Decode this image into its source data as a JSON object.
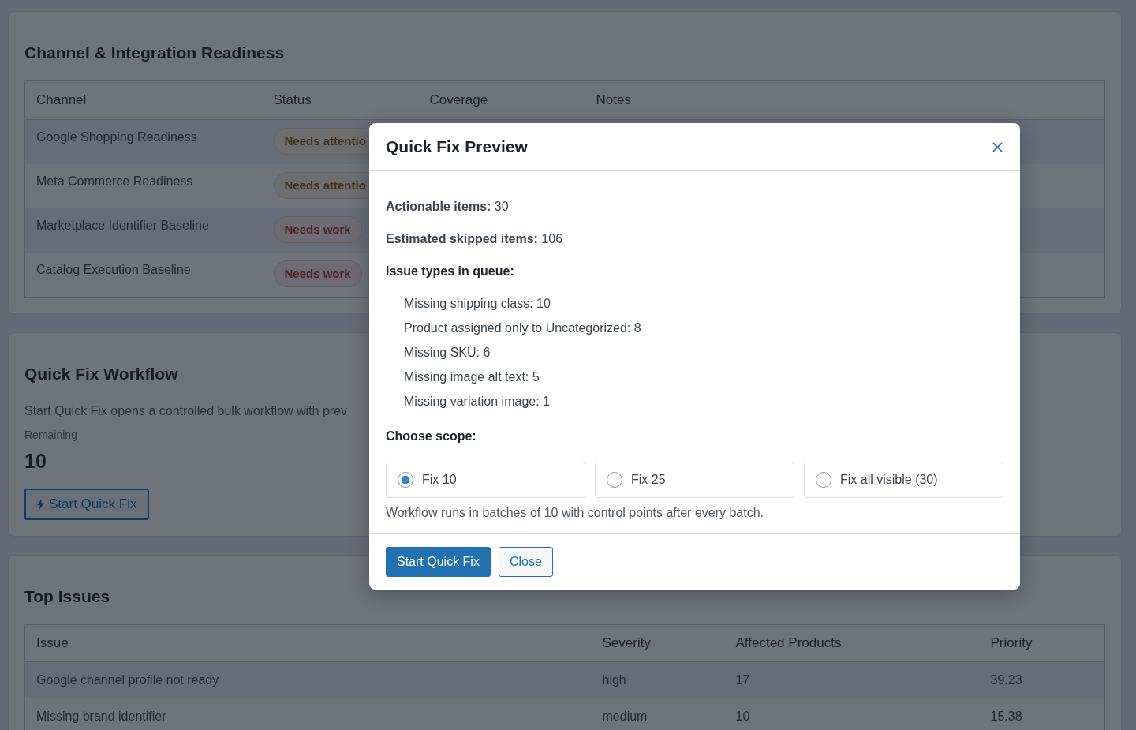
{
  "channel_readiness": {
    "title": "Channel & Integration Readiness",
    "table": {
      "columns": [
        "Channel",
        "Status",
        "Coverage",
        "Notes"
      ],
      "rows": [
        {
          "channel": "Google Shopping Readiness",
          "status": {
            "label": "Needs attentio",
            "kind": "attention"
          }
        },
        {
          "channel": "Meta Commerce Readiness",
          "status": {
            "label": "Needs attentio",
            "kind": "attention"
          }
        },
        {
          "channel": "Marketplace Identifier Baseline",
          "status": {
            "label": "Needs work",
            "kind": "work"
          }
        },
        {
          "channel": "Catalog Execution Baseline",
          "status": {
            "label": "Needs work",
            "kind": "work"
          }
        }
      ]
    }
  },
  "quick_fix_workflow": {
    "title": "Quick Fix Workflow",
    "description": "Start Quick Fix opens a controlled bulk workflow with prev",
    "remaining_label": "Remaining",
    "remaining_value": "10",
    "button": "Start Quick Fix"
  },
  "top_issues": {
    "title": "Top Issues",
    "table": {
      "columns": [
        "Issue",
        "Severity",
        "Affected Products",
        "Priority"
      ],
      "rows": [
        [
          "Google channel profile not ready",
          "high",
          "17",
          "39.23"
        ],
        [
          "Missing brand identifier",
          "medium",
          "10",
          "15.38"
        ]
      ]
    }
  },
  "modal": {
    "title": "Quick Fix Preview",
    "summary": [
      "**Actionable items:** 30",
      "**Estimated skipped items:** 106"
    ],
    "issue_types_heading": "Issue types in queue:",
    "issue_types": [
      "Missing shipping class: 10",
      "Product assigned only to Uncategorized: 8",
      "Missing SKU: 6",
      "Missing image alt text: 5",
      "Missing variation image: 1"
    ],
    "scope_heading": "Choose scope:",
    "scope_options": [
      {
        "label": "Fix 10",
        "selected": true
      },
      {
        "label": "Fix 25",
        "selected": false
      },
      {
        "label": "Fix all visible (30)",
        "selected": false
      }
    ],
    "note": "Workflow runs in batches of 10 with control points after every batch.",
    "buttons": [
      {
        "label": "Start Quick Fix",
        "kind": "primary"
      },
      {
        "label": "Close",
        "kind": "secondary"
      }
    ]
  }
}
